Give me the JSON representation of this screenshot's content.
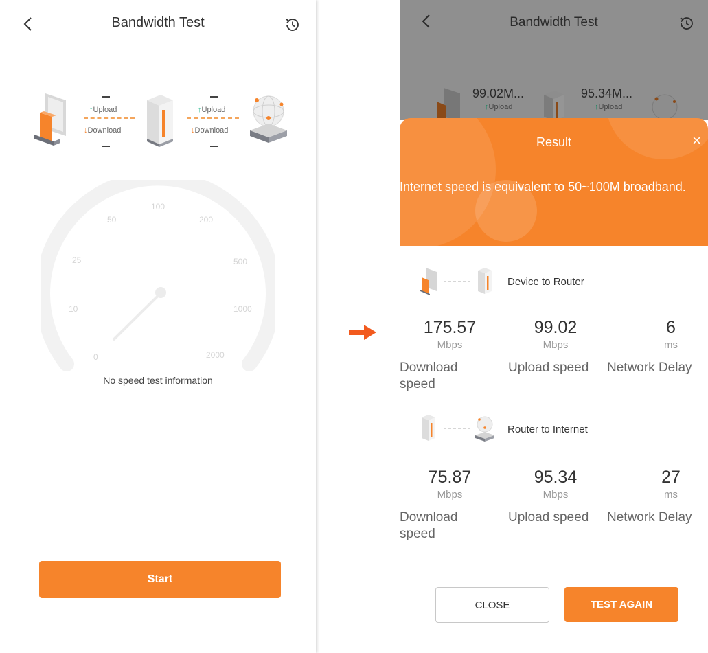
{
  "left": {
    "header": {
      "title": "Bandwidth Test"
    },
    "diagram": {
      "link1": {
        "upload_label": "Upload",
        "download_label": "Download",
        "upload_value": "—",
        "download_value": "—"
      },
      "link2": {
        "upload_label": "Upload",
        "download_label": "Download",
        "upload_value": "—",
        "download_value": "—"
      }
    },
    "gauge": {
      "tick_labels": [
        "0",
        "10",
        "25",
        "50",
        "100",
        "200",
        "500",
        "1000",
        "2000"
      ],
      "status_text": "No speed test information"
    },
    "start_label": "Start"
  },
  "right": {
    "header": {
      "title": "Bandwidth Test"
    },
    "background_values": {
      "link1_value": "99.02M...",
      "link1_label": "Upload",
      "link2_value": "95.34M...",
      "link2_label": "Upload"
    },
    "result": {
      "title": "Result",
      "close_symbol": "×",
      "description": "Internet speed is equivalent to 50~100M broadband.",
      "sections": [
        {
          "title": "Device to Router",
          "metrics": [
            {
              "value": "175.57",
              "unit": "Mbps",
              "label": "Download speed"
            },
            {
              "value": "99.02",
              "unit": "Mbps",
              "label": "Upload speed"
            },
            {
              "value": "6",
              "unit": "ms",
              "label": "Network Delay"
            }
          ]
        },
        {
          "title": "Router to Internet",
          "metrics": [
            {
              "value": "75.87",
              "unit": "Mbps",
              "label": "Download speed"
            },
            {
              "value": "95.34",
              "unit": "Mbps",
              "label": "Upload speed"
            },
            {
              "value": "27",
              "unit": "ms",
              "label": "Network Delay"
            }
          ]
        }
      ],
      "close_button": "CLOSE",
      "test_again_button": "TEST AGAIN"
    }
  },
  "colors": {
    "accent": "#f6842b",
    "upload": "#1fb58a",
    "download": "#f4822b"
  }
}
